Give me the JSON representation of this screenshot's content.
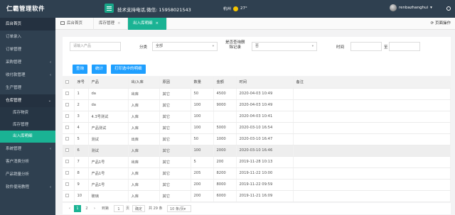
{
  "header": {
    "brand": "仁霸管理软件",
    "support": "技术支持电话,微信: 15958021543",
    "city": "杭州",
    "temperature": "27°",
    "username": "renbazhanghui",
    "user_caret": "▾"
  },
  "sidebar": {
    "items": [
      {
        "label": "后台首页",
        "arrow": ""
      },
      {
        "label": "订单录入",
        "arrow": ""
      },
      {
        "label": "订单管理",
        "arrow": ""
      },
      {
        "label": "采购管理",
        "arrow": "‹"
      },
      {
        "label": "收付款管理",
        "arrow": "‹"
      },
      {
        "label": "生产管理",
        "arrow": ""
      },
      {
        "label": "仓库管理",
        "arrow": "⌄"
      }
    ],
    "sub_items": [
      {
        "label": "库存物资"
      },
      {
        "label": "库存管理"
      },
      {
        "label": "出入库明细"
      }
    ],
    "items_after": [
      {
        "label": "系统管理",
        "arrow": "‹"
      },
      {
        "label": "客户消费分析",
        "arrow": ""
      },
      {
        "label": "产品销量分析",
        "arrow": ""
      },
      {
        "label": "软件使用教程",
        "arrow": "‹"
      }
    ]
  },
  "tabs": [
    {
      "label": "后台首页"
    },
    {
      "label": "库存管理"
    },
    {
      "label": "出入库明细"
    }
  ],
  "tab_close": "×",
  "page_ops": "页面操作",
  "filter": {
    "product_placeholder": "请输入产品",
    "category_label": "分类",
    "category_value": "全部",
    "show_label_1": "是否查询删",
    "show_label_2": "除记录",
    "show_value": "否",
    "time_label": "时间",
    "to_label": "至",
    "select_arrow": "▾",
    "buttons": {
      "query": "查询",
      "stats": "统计",
      "print": "打印选中的明细"
    }
  },
  "table": {
    "headers": [
      "",
      "序号",
      "产品",
      "出/入库",
      "原因",
      "数量",
      "金额",
      "时间",
      "备注"
    ],
    "rows": [
      [
        "1",
        "da",
        "出库",
        "其它",
        "50",
        "4500",
        "2020-04-03 10:49",
        ""
      ],
      [
        "2",
        "da",
        "入库",
        "其它",
        "100",
        "9000",
        "2020-04-03 10:49",
        ""
      ],
      [
        "3",
        "4.3号测试",
        "入库",
        "其它",
        "100",
        "",
        "2020-04-03 10:41",
        ""
      ],
      [
        "4",
        "产品测试",
        "入库",
        "其它",
        "100",
        "5000",
        "2020-03-10 16:54",
        ""
      ],
      [
        "5",
        "测试",
        "出库",
        "其它",
        "50",
        "1000",
        "2020-03-10 16:47",
        ""
      ],
      [
        "6",
        "测试",
        "入库",
        "其它",
        "100",
        "2000",
        "2020-03-10 16:46",
        ""
      ],
      [
        "7",
        "产品1号",
        "出库",
        "其它",
        "5",
        "200",
        "2019-11-28 10:13",
        ""
      ],
      [
        "8",
        "产品1号",
        "入库",
        "其它",
        "205",
        "8200",
        "2019-11-22 10:00",
        ""
      ],
      [
        "9",
        "产品1号",
        "入库",
        "其它",
        "200",
        "8000",
        "2019-11-22 09:59",
        ""
      ],
      [
        "10",
        "玻璃",
        "入库",
        "其它",
        "200",
        "6000",
        "2019-11-21 16:09",
        ""
      ]
    ]
  },
  "pager": {
    "prev": "‹",
    "current": "1",
    "page2": "2",
    "next": "›",
    "goto_label": "到第",
    "goto_value": "1",
    "page_unit": "页",
    "confirm": "确定",
    "total": "共 29 条",
    "per_page": "10 条/页",
    "per_page_arrow": "▾"
  },
  "colors": {
    "sidebar": "#2f4050",
    "accent": "#1ab394",
    "button": "#1e9fff"
  }
}
